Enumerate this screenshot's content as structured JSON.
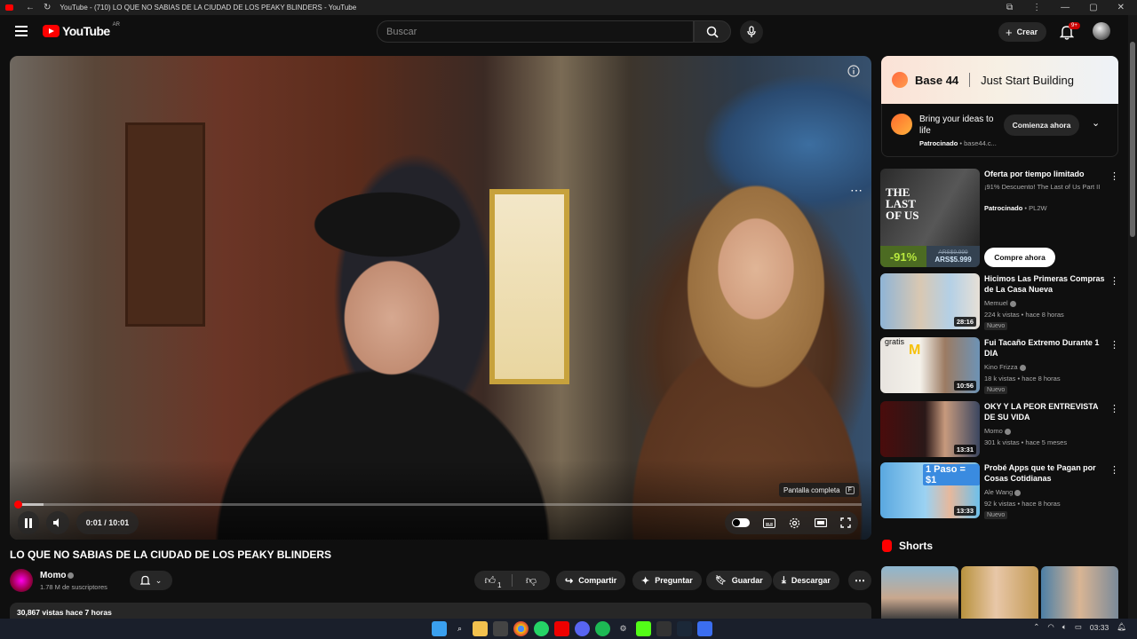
{
  "browser": {
    "tab_title": "YouTube - (710) LO QUE NO SABIAS DE LA CIUDAD DE LOS PEAKY BLINDERS - YouTube"
  },
  "header": {
    "logo_text": "YouTube",
    "country_code": "AR",
    "search_placeholder": "Buscar",
    "create_label": "Crear",
    "notification_count": "9+"
  },
  "player": {
    "time_display": "0:01 / 10:01",
    "progress_fraction": 0.002,
    "buffer_fraction": 0.03,
    "fullscreen_tooltip": "Pantalla completa",
    "fullscreen_key": "F"
  },
  "video": {
    "title": "LO QUE NO SABIAS DE LA CIUDAD DE LOS PEAKY BLINDERS",
    "channel": "Momo",
    "subscribers": "1.78 M de suscriptores",
    "like_count": "1",
    "share_label": "Compartir",
    "ask_label": "Preguntar",
    "save_label": "Guardar",
    "download_label": "Descargar",
    "views_line": "30,867 vistas  hace 7 horas"
  },
  "ad": {
    "brand": "Base 44",
    "tagline": "Just Start Building",
    "headline": "Bring your ideas to life",
    "sponsored": "Patrocinado",
    "domain": "base44.c...",
    "cta": "Comienza ahora"
  },
  "promo": {
    "title": "Oferta por tiempo limitado",
    "subtitle": "¡91% Descuento! The Last of Us Part II",
    "sponsored": "Patrocinado",
    "sponsor": "PL2W",
    "discount": "-91%",
    "old_price": "ARS$9,999",
    "new_price": "ARS$5.999",
    "cta": "Compre ahora"
  },
  "recommendations": [
    {
      "title": "Hicimos Las Primeras Compras de La Casa Nueva",
      "channel": "Memuel",
      "stats": "224 k vistas • hace 8 horas",
      "duration": "28:16",
      "badge": "Nuevo"
    },
    {
      "title": "Fui Tacaño Extremo Durante 1 DIA",
      "channel": "Kino Frizza",
      "stats": "18 k vistas • hace 8 horas",
      "duration": "10:56",
      "badge": "Nuevo",
      "thumb_text": "gratis"
    },
    {
      "title": "OKY Y LA PEOR ENTREVISTA DE SU VIDA",
      "channel": "Momo",
      "stats": "301 k vistas • hace 5 meses",
      "duration": "13:31",
      "badge": ""
    },
    {
      "title": "Probé Apps que te Pagan por Cosas Cotidianas",
      "channel": "Ale Wang",
      "stats": "92 k vistas • hace 8 horas",
      "duration": "13:33",
      "badge": "Nuevo",
      "thumb_text": "1 Paso = $1"
    }
  ],
  "shorts": {
    "label": "Shorts"
  },
  "taskbar": {
    "time": "03:33"
  }
}
